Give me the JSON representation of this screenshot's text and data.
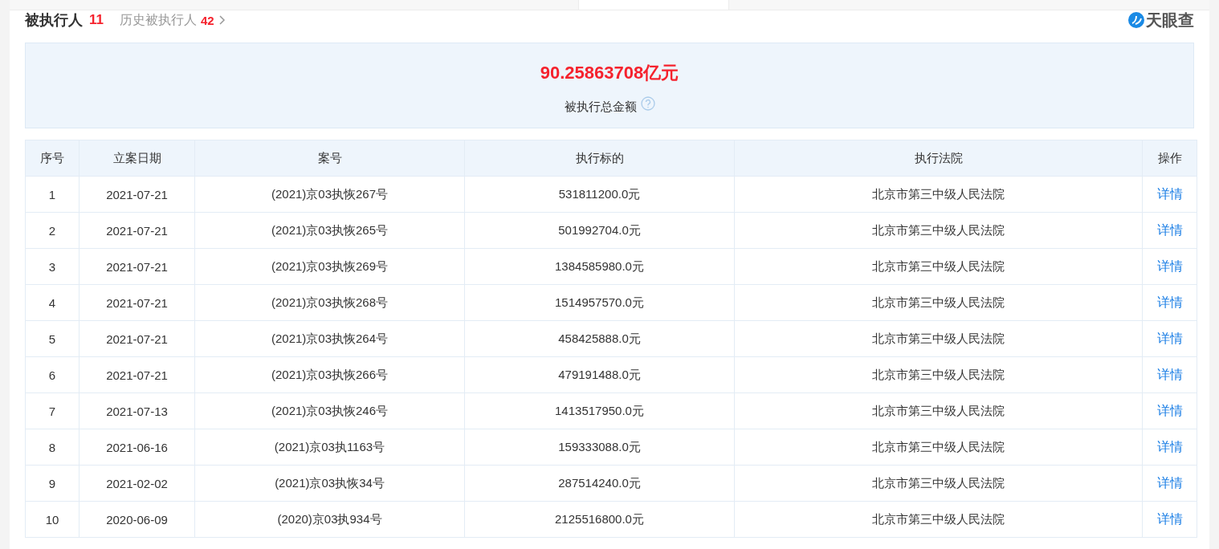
{
  "header": {
    "title": "被执行人",
    "count": "11",
    "history_label": "历史被执行人",
    "history_count": "42",
    "logo_text": "天眼查"
  },
  "summary": {
    "amount": "90.25863708",
    "unit": "亿元",
    "label": "被执行总金额"
  },
  "table": {
    "columns": [
      "序号",
      "立案日期",
      "案号",
      "执行标的",
      "执行法院",
      "操作"
    ],
    "rows": [
      {
        "index": "1",
        "date": "2021-07-21",
        "case_no": "(2021)京03执恢267号",
        "amount": "531811200.0元",
        "court": "北京市第三中级人民法院",
        "action": "详情"
      },
      {
        "index": "2",
        "date": "2021-07-21",
        "case_no": "(2021)京03执恢265号",
        "amount": "501992704.0元",
        "court": "北京市第三中级人民法院",
        "action": "详情"
      },
      {
        "index": "3",
        "date": "2021-07-21",
        "case_no": "(2021)京03执恢269号",
        "amount": "1384585980.0元",
        "court": "北京市第三中级人民法院",
        "action": "详情"
      },
      {
        "index": "4",
        "date": "2021-07-21",
        "case_no": "(2021)京03执恢268号",
        "amount": "1514957570.0元",
        "court": "北京市第三中级人民法院",
        "action": "详情"
      },
      {
        "index": "5",
        "date": "2021-07-21",
        "case_no": "(2021)京03执恢264号",
        "amount": "458425888.0元",
        "court": "北京市第三中级人民法院",
        "action": "详情"
      },
      {
        "index": "6",
        "date": "2021-07-21",
        "case_no": "(2021)京03执恢266号",
        "amount": "479191488.0元",
        "court": "北京市第三中级人民法院",
        "action": "详情"
      },
      {
        "index": "7",
        "date": "2021-07-13",
        "case_no": "(2021)京03执恢246号",
        "amount": "1413517950.0元",
        "court": "北京市第三中级人民法院",
        "action": "详情"
      },
      {
        "index": "8",
        "date": "2021-06-16",
        "case_no": "(2021)京03执1163号",
        "amount": "159333088.0元",
        "court": "北京市第三中级人民法院",
        "action": "详情"
      },
      {
        "index": "9",
        "date": "2021-02-02",
        "case_no": "(2021)京03执恢34号",
        "amount": "287514240.0元",
        "court": "北京市第三中级人民法院",
        "action": "详情"
      },
      {
        "index": "10",
        "date": "2020-06-09",
        "case_no": "(2020)京03执934号",
        "amount": "2125516800.0元",
        "court": "北京市第三中级人民法院",
        "action": "详情"
      }
    ]
  }
}
